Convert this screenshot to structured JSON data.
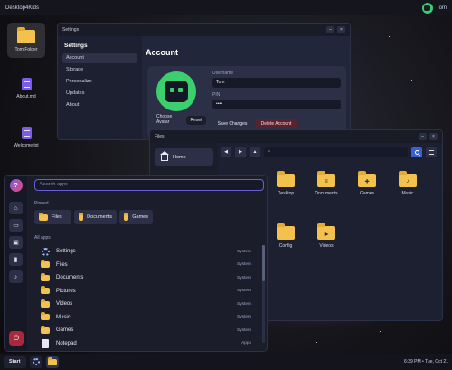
{
  "topbar": {
    "title": "Desktop4Kids",
    "user": "Tom"
  },
  "desktop": {
    "icons": [
      {
        "label": "Tom Folder"
      },
      {
        "label": "About.md"
      },
      {
        "label": "Welcome.txt"
      }
    ]
  },
  "settings": {
    "title": "Settings",
    "sidebar_heading": "Settings",
    "items": [
      "Account",
      "Storage",
      "Personalize",
      "Updates",
      "About"
    ],
    "page_title": "Account",
    "choose_avatar": "Choose Avatar",
    "reset": "Reset",
    "username_label": "Username",
    "username_value": "Tom",
    "pin_label": "PIN",
    "pin_value": "••••",
    "save": "Save Changes",
    "delete": "Delete Account",
    "min": "–",
    "close": "×"
  },
  "files": {
    "title": "Files",
    "sidebar": [
      "Home"
    ],
    "path": "~",
    "nav": {
      "back": "◀",
      "forward": "▶",
      "up": "▲"
    },
    "items": [
      "Desktop",
      "Documents",
      "Games",
      "Music",
      "Config",
      "Videos"
    ],
    "min": "–",
    "close": "×"
  },
  "startmenu": {
    "search_placeholder": "Search apps...",
    "pinned_label": "Pinned",
    "pinned": [
      "Files",
      "Documents",
      "Games"
    ],
    "allapps_label": "All apps",
    "apps": [
      {
        "name": "Settings",
        "category": "System",
        "icon": "gear-icon"
      },
      {
        "name": "Files",
        "category": "System",
        "icon": "folder-icon"
      },
      {
        "name": "Documents",
        "category": "System",
        "icon": "folder-icon"
      },
      {
        "name": "Pictures",
        "category": "System",
        "icon": "folder-icon"
      },
      {
        "name": "Videos",
        "category": "System",
        "icon": "folder-icon"
      },
      {
        "name": "Music",
        "category": "System",
        "icon": "folder-icon"
      },
      {
        "name": "Games",
        "category": "System",
        "icon": "folder-icon"
      },
      {
        "name": "Notepad",
        "category": "Apps",
        "icon": "document-icon"
      }
    ],
    "rail": {
      "logo": "?",
      "home": "⌂",
      "files": "▭",
      "images": "▣",
      "docs": "▮",
      "music": "♪",
      "power": "⏻"
    }
  },
  "taskbar": {
    "start": "Start",
    "clock": "6:39 PM • Tue, Oct 21"
  },
  "colors": {
    "accent": "#6b5fd8",
    "avatar": "#3ccf6e",
    "danger": "#a8283c",
    "folder": "#f2c14e"
  }
}
